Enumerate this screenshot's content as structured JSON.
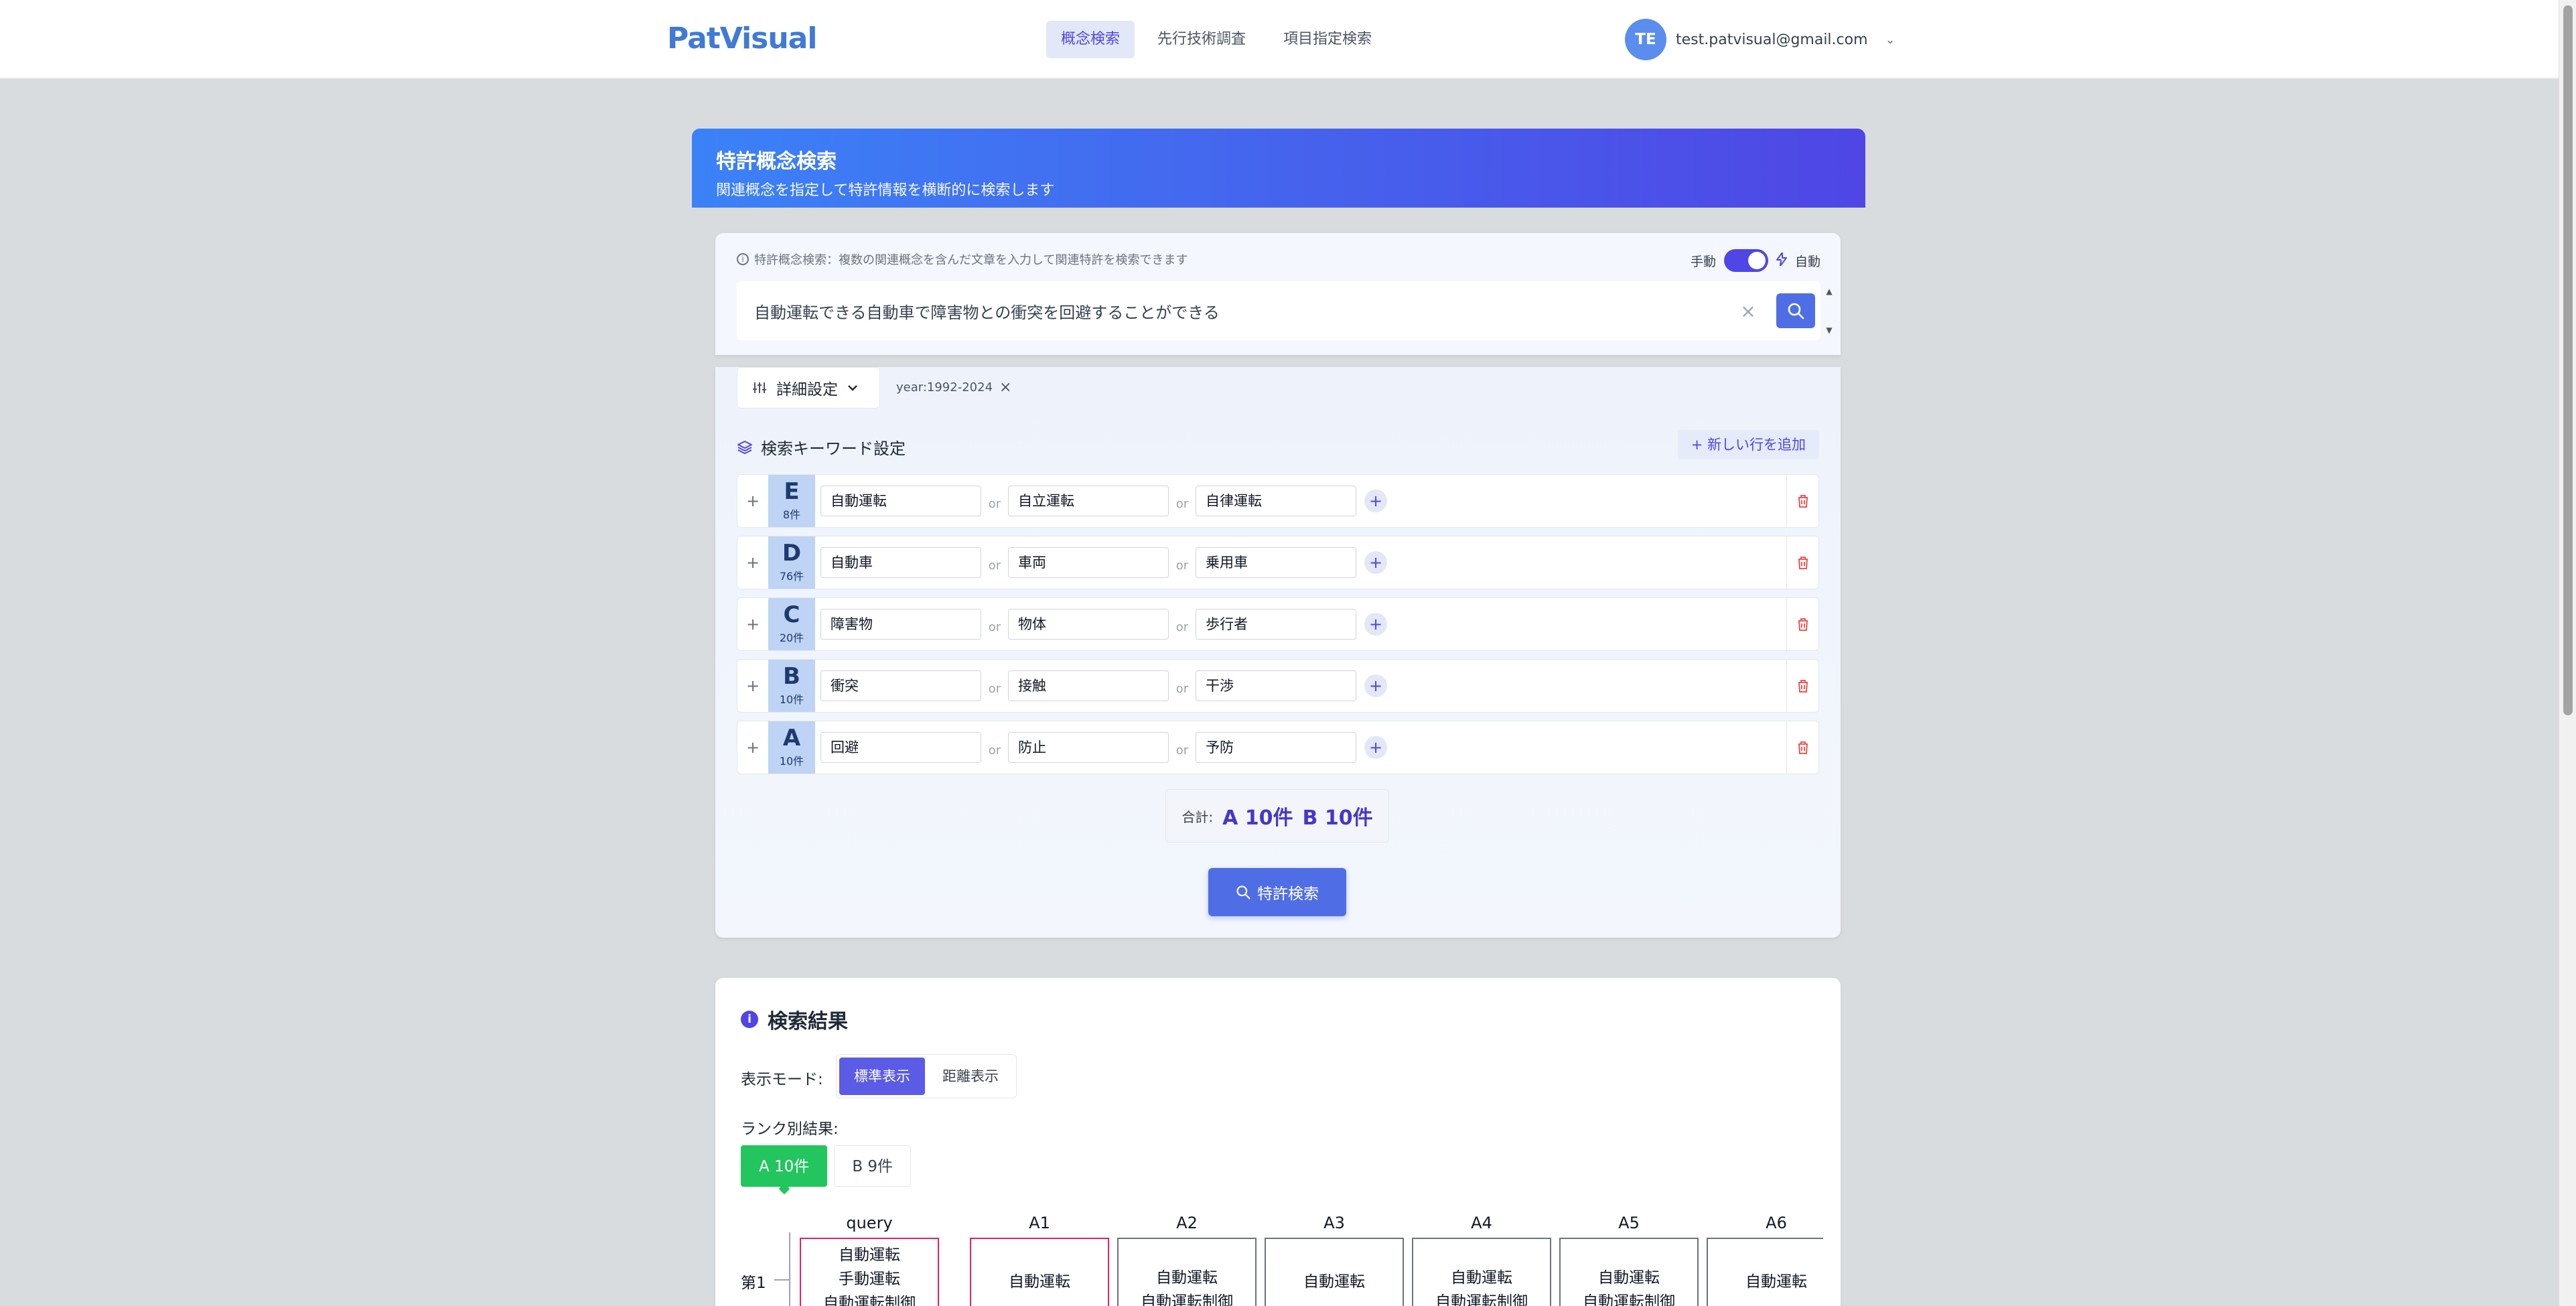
{
  "header": {
    "logo": "PatVisual",
    "nav": [
      {
        "label": "概念検索",
        "active": true
      },
      {
        "label": "先行技術調査",
        "active": false
      },
      {
        "label": "項目指定検索",
        "active": false
      }
    ],
    "avatar_initials": "TE",
    "email": "test.patvisual@gmail.com"
  },
  "banner": {
    "title": "特許概念検索",
    "subtitle": "関連概念を指定して特許情報を横断的に検索します"
  },
  "search": {
    "hint": "特許概念検索：複数の関連概念を含んだ文章を入力して関連特許を検索できます",
    "mode_manual": "手動",
    "mode_auto": "自動",
    "mode_is_auto": true,
    "query": "自動運転できる自動車で障害物との衝突を回避することができる"
  },
  "settings": {
    "detail_label": "詳細設定",
    "filter_tag": "year:1992-2024",
    "keyword_title": "検索キーワード設定",
    "add_row_label": "+ 新しい行を追加",
    "or_label": "or",
    "rows": [
      {
        "letter": "E",
        "count": "8件",
        "terms": [
          "自動運転",
          "自立運転",
          "自律運転"
        ]
      },
      {
        "letter": "D",
        "count": "76件",
        "terms": [
          "自動車",
          "車両",
          "乗用車"
        ]
      },
      {
        "letter": "C",
        "count": "20件",
        "terms": [
          "障害物",
          "物体",
          "歩行者"
        ]
      },
      {
        "letter": "B",
        "count": "10件",
        "terms": [
          "衝突",
          "接触",
          "干渉"
        ]
      },
      {
        "letter": "A",
        "count": "10件",
        "terms": [
          "回避",
          "防止",
          "予防"
        ]
      }
    ],
    "total_label": "合計:",
    "total_a": "A 10件",
    "total_b": "B 10件",
    "search_button": "特許検索"
  },
  "results": {
    "title": "検索結果",
    "mode_label": "表示モード:",
    "modes": [
      {
        "label": "標準表示",
        "active": true
      },
      {
        "label": "距離表示",
        "active": false
      }
    ],
    "rank_label": "ランク別結果:",
    "ranks": [
      {
        "label": "A 10件",
        "active": true
      },
      {
        "label": "B 9件",
        "active": false
      }
    ],
    "row_label": "第1",
    "columns": [
      {
        "head": "query",
        "lines": [
          "自動運転",
          "手動運転",
          "自動運転制御"
        ]
      },
      {
        "head": "A1",
        "lines": [
          "自動運転"
        ]
      },
      {
        "head": "A2",
        "lines": [
          "自動運転",
          "自動運転制御"
        ]
      },
      {
        "head": "A3",
        "lines": [
          "自動運転"
        ]
      },
      {
        "head": "A4",
        "lines": [
          "自動運転",
          "自動運転制御"
        ]
      },
      {
        "head": "A5",
        "lines": [
          "自動運転",
          "自動運転制御"
        ]
      },
      {
        "head": "A6",
        "lines": [
          "自動運転"
        ]
      }
    ]
  },
  "colors": {
    "accent": "#4f46e5",
    "brand": "#3f7ad6",
    "success": "#22c55e",
    "danger": "#ef4444",
    "query_border": "#e91e63"
  }
}
